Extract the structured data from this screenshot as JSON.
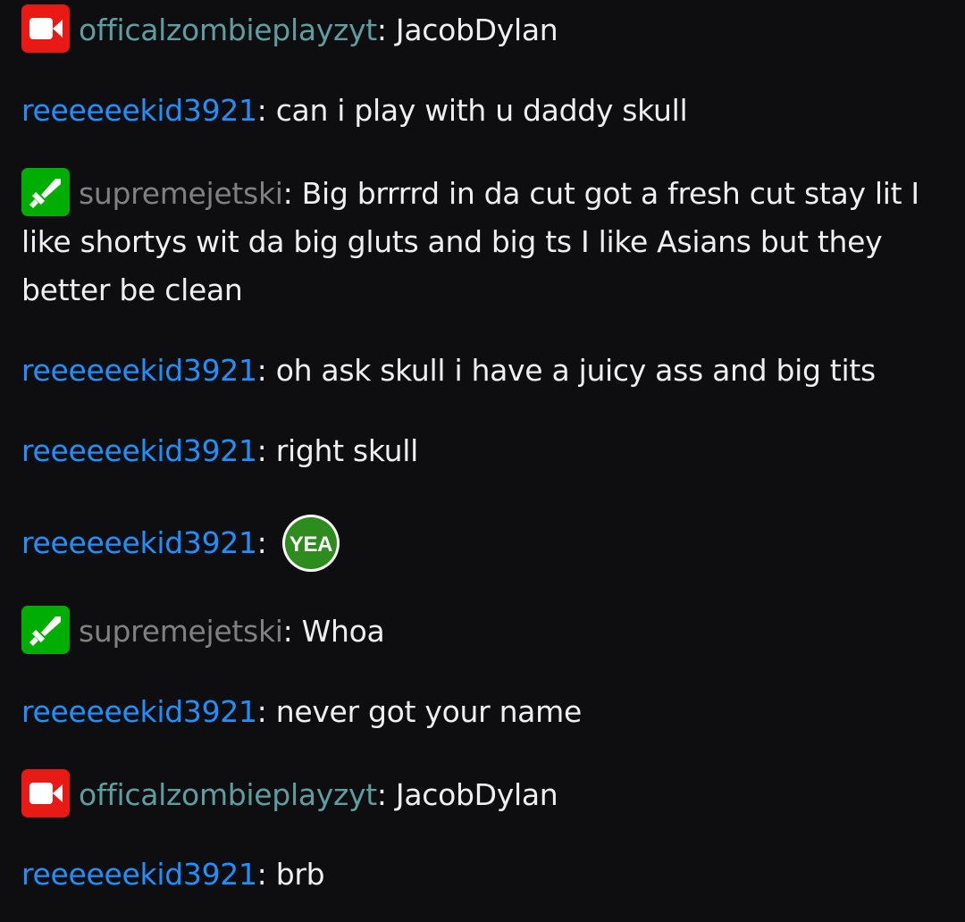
{
  "colors": {
    "background": "#0e0e10",
    "text": "#efeff1",
    "officalzombieplayzyt": "#5f9ea0",
    "reeeeeekid3921": "#1e90ff",
    "supremejetski": "#808080",
    "broadcaster_badge": "#e91916",
    "moderator_badge": "#00ad03"
  },
  "messages": [
    {
      "username": "officalzombieplayzyt",
      "separator": ":",
      "text": "JacobDylan",
      "badge": "broadcaster-camera-icon"
    },
    {
      "username": "reeeeeekid3921",
      "separator": ":",
      "text": "can i play with u daddy skull",
      "badge": ""
    },
    {
      "username": "supremejetski",
      "separator": ":",
      "text": "Big brrrrd in da cut got a fresh cut stay lit  I like shortys wit da big gluts and big ts  I like Asians but they better be clean",
      "badge": "moderator-sword-icon"
    },
    {
      "username": "reeeeeekid3921",
      "separator": ":",
      "text": "oh ask skull i have a juicy ass and big tits",
      "badge": ""
    },
    {
      "username": "reeeeeekid3921",
      "separator": ":",
      "text": "right skull",
      "badge": ""
    },
    {
      "username": "reeeeeekid3921",
      "separator": ":",
      "text": "",
      "badge": "",
      "emote": "YEA"
    },
    {
      "username": "supremejetski",
      "separator": ":",
      "text": "Whoa",
      "badge": "moderator-sword-icon"
    },
    {
      "username": "reeeeeekid3921",
      "separator": ":",
      "text": "never got your name",
      "badge": ""
    },
    {
      "username": "officalzombieplayzyt",
      "separator": ":",
      "text": "JacobDylan",
      "badge": "broadcaster-camera-icon"
    },
    {
      "username": "reeeeeekid3921",
      "separator": ":",
      "text": "brb",
      "badge": ""
    }
  ]
}
